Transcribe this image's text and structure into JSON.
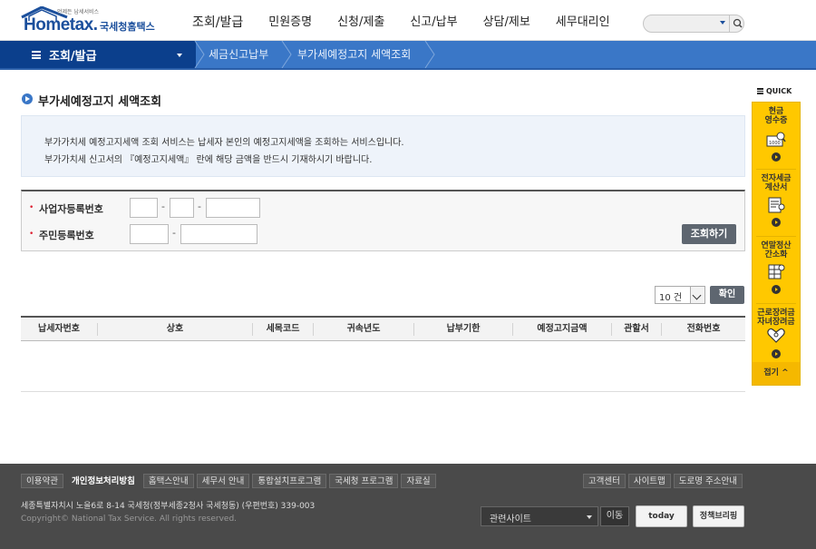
{
  "logo": {
    "brand": "Hometax.",
    "sub": "언제든 납세서비스",
    "kr": "국세청홈택스"
  },
  "gnb": [
    "조회/발급",
    "민원증명",
    "신청/제출",
    "신고/납부",
    "상담/제보",
    "세무대리인"
  ],
  "search": {
    "placeholder": ""
  },
  "nav": {
    "menu_label": "조회/발급",
    "crumbs": [
      "세금신고납부",
      "부가세예정고지 세액조회"
    ]
  },
  "page_title": "부가세예정고지 세액조회",
  "info_lines": [
    "부가가치세 예정고지세액 조회 서비스는 납세자 본인의 예정고지세액을 조회하는 서비스입니다.",
    "부가가치세 신고서의 『예정고지세액』 란에 해당 금액을 반드시 기재하시기 바랍니다."
  ],
  "form": {
    "biz_no_label": "사업자등록번호",
    "resident_no_label": "주민등록번호",
    "dash": "-",
    "query_button": "조회하기"
  },
  "page_size": {
    "value": "10 건",
    "confirm": "확인"
  },
  "table": {
    "columns": [
      "납세자번호",
      "상호",
      "세목코드",
      "귀속년도",
      "납부기한",
      "예정고지금액",
      "관할서",
      "전화번호"
    ]
  },
  "quick": {
    "title": "QUICK",
    "items": [
      {
        "label1": "현금",
        "label2": "영수증",
        "icon": "receipt-icon"
      },
      {
        "label1": "전자세금",
        "label2": "계산서",
        "icon": "invoice-icon"
      },
      {
        "label1": "연말정산",
        "label2": "간소화",
        "icon": "year-end-icon"
      },
      {
        "label1": "근로장려금",
        "label2": "자녀장려금",
        "icon": "incentive-icon"
      }
    ],
    "fold": "접기 ^"
  },
  "footer": {
    "links_left": [
      "이용약관",
      "개인정보처리방침",
      "홈택스안내",
      "세무서 안내",
      "통합설치프로그램",
      "국세청 프로그램",
      "자료실"
    ],
    "links_right": [
      "고객센터",
      "사이트맵",
      "도로명 주소안내"
    ],
    "address": "세종특별자치시 노을6로 8-14 국세청(정부세종2청사 국세청동) (우편번호) 339-003",
    "copyright": "Copyright© National Tax Service. All rights reserved.",
    "related_sites": "관련사이트",
    "go": "이동",
    "badge1": "today",
    "badge2": "정책브리핑"
  }
}
